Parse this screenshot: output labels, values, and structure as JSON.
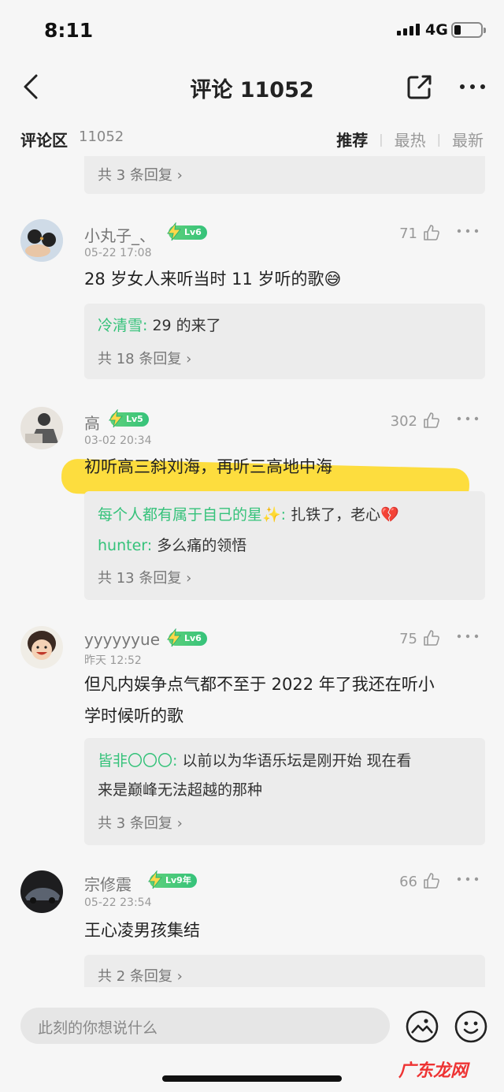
{
  "status": {
    "time": "8:11",
    "network": "4G"
  },
  "nav": {
    "title": "评论 11052"
  },
  "section": {
    "title": "评论区",
    "count": "11052",
    "sort": [
      "推荐",
      "最热",
      "最新"
    ],
    "active_sort": "推荐"
  },
  "top_partial": {
    "more_replies": "共 3 条回复 ›"
  },
  "comments": [
    {
      "username": "小丸子_、",
      "level": "Lv6",
      "time": "05-22 17:08",
      "likes": "71",
      "text": "28 岁女人来听当时 11 岁听的歌😅",
      "replies": [
        {
          "user": "冷清雪:",
          "text": " 29 的来了"
        }
      ],
      "more_replies": "共 18 条回复 ›"
    },
    {
      "username": "高",
      "level": "Lv5",
      "time": "03-02 20:34",
      "likes": "302",
      "text": "初听高三斜刘海，再听三高地中海",
      "replies": [
        {
          "user": "每个人都有属于自己的星✨:",
          "text": " 扎铁了，老心💔"
        },
        {
          "user": "hunter:",
          "text": " 多么痛的领悟"
        }
      ],
      "more_replies": "共 13 条回复 ›"
    },
    {
      "username": "yyyyyyue",
      "level": "Lv6",
      "time": "昨天 12:52",
      "likes": "75",
      "text_lines": [
        "但凡内娱争点气都不至于 2022 年了我还在听小",
        "学时候听的歌"
      ],
      "replies": [
        {
          "user": "皆非〇〇〇:",
          "text": " 以前以为华语乐坛是刚开始 现在看"
        },
        {
          "user": "",
          "text": "来是巅峰无法超越的那种"
        }
      ],
      "more_replies": "共 3 条回复 ›"
    },
    {
      "username": "宗修震",
      "level": "Lv9年",
      "time": "05-22 23:54",
      "likes": "66",
      "text": "王心凌男孩集结",
      "replies": [],
      "more_replies": "共 2 条回复 ›"
    }
  ],
  "input": {
    "placeholder": "此刻的你想说什么"
  },
  "watermark": "广东龙网",
  "colors": {
    "accent_green": "#35c27a",
    "highlight_yellow": "#ffd60a",
    "background": "#f6f6f6"
  }
}
